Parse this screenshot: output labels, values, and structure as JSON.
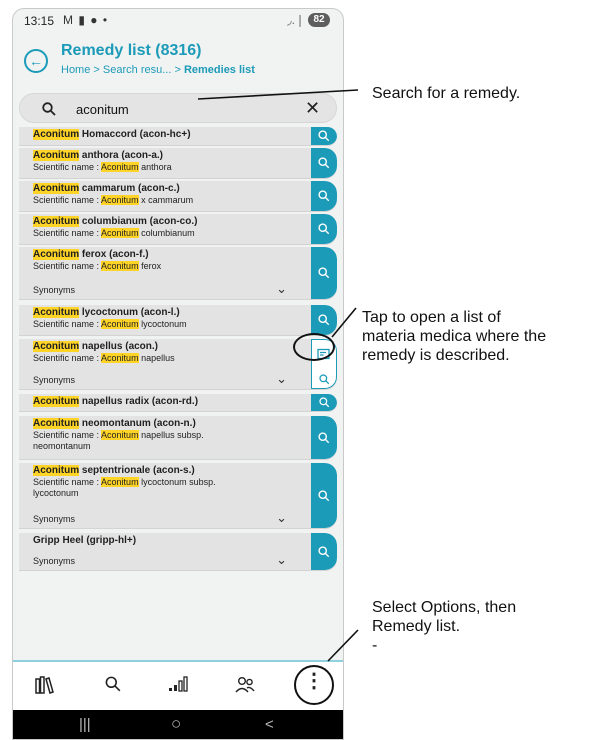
{
  "status_bar": {
    "time": "13:15",
    "icons": "M ▮ ●  •",
    "signal": "◞.❘",
    "battery": "82"
  },
  "header": {
    "title": "Remedy list (8316)",
    "breadcrumb": [
      "Home",
      "Search resu...",
      "Remedies list"
    ],
    "separator": ">"
  },
  "search": {
    "value": "aconitum",
    "placeholder": "Search"
  },
  "items": [
    {
      "hl": "Aconitum",
      "name_rest": " Homaccord (acon-hc+)"
    },
    {
      "hl": "Aconitum",
      "name_rest": " anthora (acon-a.)",
      "sci_prefix": "Scientific name : ",
      "sci_rest": " anthora"
    },
    {
      "hl": "Aconitum",
      "name_rest": " cammarum (acon-c.)",
      "sci_prefix": "Scientific name : ",
      "sci_rest": " x cammarum"
    },
    {
      "hl": "Aconitum",
      "name_rest": " columbianum (acon-co.)",
      "sci_prefix": "Scientific name : ",
      "sci_rest": " columbianum"
    },
    {
      "hl": "Aconitum",
      "name_rest": " ferox (acon-f.)",
      "sci_prefix": "Scientific name : ",
      "sci_rest": " ferox",
      "synonyms": "Synonyms"
    },
    {
      "hl": "Aconitum",
      "name_rest": " lycoctonum (acon-l.)",
      "sci_prefix": "Scientific name : ",
      "sci_rest": " lycoctonum"
    },
    {
      "hl": "Aconitum",
      "name_rest": " napellus (acon.)",
      "sci_prefix": "Scientific name : ",
      "sci_rest": " napellus",
      "synonyms": "Synonyms"
    },
    {
      "hl": "Aconitum",
      "name_rest": " napellus radix (acon-rd.)"
    },
    {
      "hl": "Aconitum",
      "name_rest": " neomontanum (acon-n.)",
      "sci_prefix": "Scientific name : ",
      "sci_rest": " napellus subsp.",
      "sci_line2": "neomontanum"
    },
    {
      "hl": "Aconitum",
      "name_rest": " septentrionale (acon-s.)",
      "sci_prefix": "Scientific name : ",
      "sci_rest": " lycoctonum subsp.",
      "sci_line2": "lycoctonum",
      "synonyms": "Synonyms"
    },
    {
      "name_plain": "Gripp Heel (gripp-hl+)",
      "synonyms": "Synonyms"
    }
  ],
  "annotations": {
    "search": "Search for a remedy.",
    "materia_medica": [
      "Tap to open a list of",
      "materia medica where the",
      "remedy is described."
    ],
    "options": [
      "Select Options, then",
      "Remedy list.",
      "-"
    ]
  },
  "colors": {
    "accent": "#1c9bb8",
    "highlight": "#ffd426",
    "item_bg": "#e3e3e3"
  }
}
